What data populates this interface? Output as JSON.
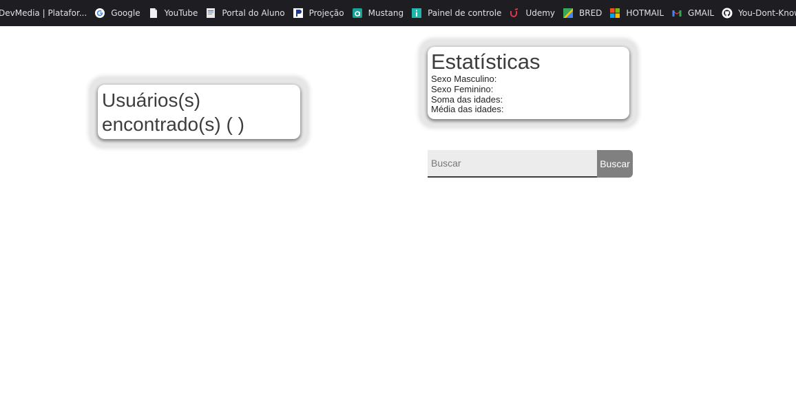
{
  "bookmarks": [
    {
      "label": "DevMedia | Platafor...",
      "icon": "devmedia-icon"
    },
    {
      "label": "Google",
      "icon": "google-icon"
    },
    {
      "label": "YouTube",
      "icon": "document-icon"
    },
    {
      "label": "Portal do Aluno",
      "icon": "page-icon"
    },
    {
      "label": "Projeção",
      "icon": "projecao-icon"
    },
    {
      "label": "Mustang",
      "icon": "mustang-icon"
    },
    {
      "label": "Painel de controle",
      "icon": "info-icon"
    },
    {
      "label": "Udemy",
      "icon": "udemy-icon"
    },
    {
      "label": "BRED",
      "icon": "bred-icon"
    },
    {
      "label": "HOTMAIL",
      "icon": "microsoft-icon"
    },
    {
      "label": "GMAIL",
      "icon": "gmail-icon"
    },
    {
      "label": "You-Dont-Know-JS/...",
      "icon": "github-icon"
    }
  ],
  "users": {
    "title": "Usuários(s) encontrado(s) ( )"
  },
  "stats": {
    "title": "Estatísticas",
    "male": "Sexo Masculino:",
    "female": "Sexo Feminino:",
    "age_sum": "Soma das idades:",
    "age_avg": "Média das idades:"
  },
  "search": {
    "placeholder": "Buscar",
    "value": "",
    "button_label": "Buscar"
  },
  "colors": {
    "bookmark_bar": "#1d1d22",
    "button": "#808080",
    "input_bg": "#ececec"
  }
}
